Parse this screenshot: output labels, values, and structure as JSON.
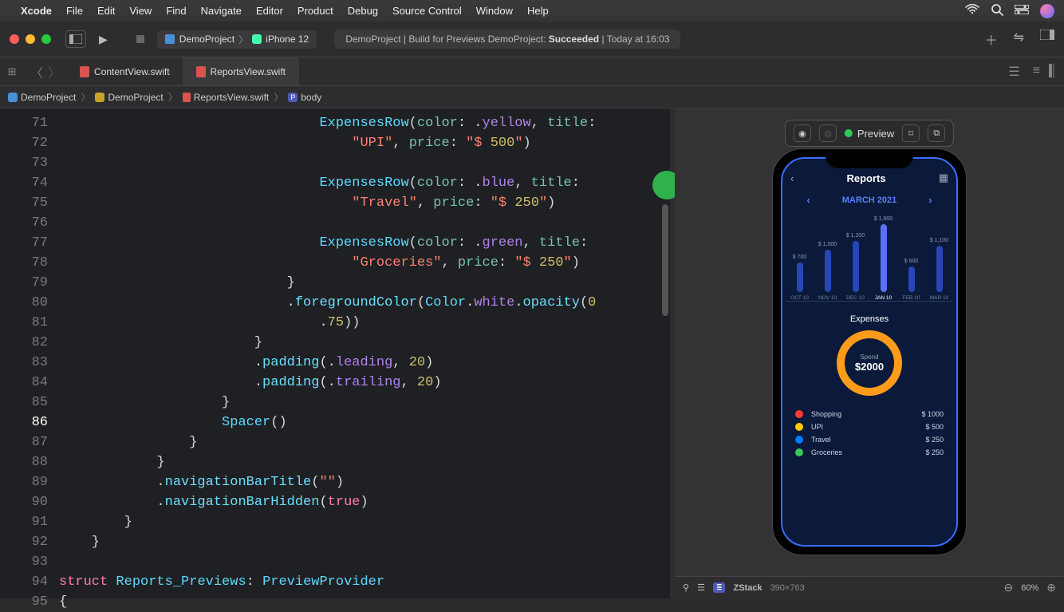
{
  "menubar": {
    "app": "Xcode",
    "items": [
      "File",
      "Edit",
      "View",
      "Find",
      "Navigate",
      "Editor",
      "Product",
      "Debug",
      "Source Control",
      "Window",
      "Help"
    ]
  },
  "titlebar": {
    "scheme_project": "DemoProject",
    "scheme_device": "iPhone 12",
    "status_prefix": "DemoProject | Build for Previews DemoProject: ",
    "status_bold": "Succeeded",
    "status_suffix": " | Today at 16:03"
  },
  "tabs": [
    {
      "label": "ContentView.swift",
      "active": false
    },
    {
      "label": "ReportsView.swift",
      "active": true
    }
  ],
  "jumpbar": [
    "DemoProject",
    "DemoProject",
    "ReportsView.swift",
    "body"
  ],
  "jumpbar_prefix": "P",
  "editor": {
    "first_line": 71,
    "lines": [
      "                                ExpensesRow(color: .yellow, title:",
      "                                    \"UPI\", price: \"$ 500\")",
      "",
      "                                ExpensesRow(color: .blue, title:",
      "                                    \"Travel\", price: \"$ 250\")",
      "",
      "                                ExpensesRow(color: .green, title:",
      "                                    \"Groceries\", price: \"$ 250\")",
      "                            }",
      "                            .foregroundColor(Color.white.opacity(0",
      "                                .75))",
      "                        }",
      "                        .padding(.leading, 20)",
      "                        .padding(.trailing, 20)",
      "                    }",
      "                    Spacer()",
      "                }",
      "            }",
      "            .navigationBarTitle(\"\")",
      "            .navigationBarHidden(true)",
      "        }",
      "    }",
      "",
      "struct Reports_Previews: PreviewProvider",
      "{"
    ],
    "breakpoint_count": "1"
  },
  "preview_toolbar_label": "Preview",
  "preview_app": {
    "title": "Reports",
    "month": "MARCH 2021",
    "expenses_label": "Expenses",
    "ring_label": "Spend",
    "ring_amount": "$2000",
    "rows": [
      {
        "label": "Shopping",
        "price": "$ 1000",
        "color": "#ff3b30"
      },
      {
        "label": "UPI",
        "price": "$ 500",
        "color": "#ffcc00"
      },
      {
        "label": "Travel",
        "price": "$ 250",
        "color": "#007aff"
      },
      {
        "label": "Groceries",
        "price": "$ 250",
        "color": "#34c759"
      }
    ]
  },
  "chart_data": {
    "type": "bar",
    "title": "MARCH 2021",
    "categories": [
      "OCT 10",
      "NOV 10",
      "DEC 10",
      "JAN 10",
      "FEB 10",
      "MAR 10"
    ],
    "values": [
      700,
      1000,
      1200,
      1600,
      600,
      1100
    ],
    "value_labels": [
      "$ 700",
      "$ 1,000",
      "$ 1,200",
      "$ 1,600",
      "$ 600",
      "$ 1,100"
    ],
    "highlight_index": 3,
    "ylim": [
      0,
      1600
    ]
  },
  "canvas_footer": {
    "stack": "ZStack",
    "size": "390×763",
    "zoom": "60%"
  }
}
